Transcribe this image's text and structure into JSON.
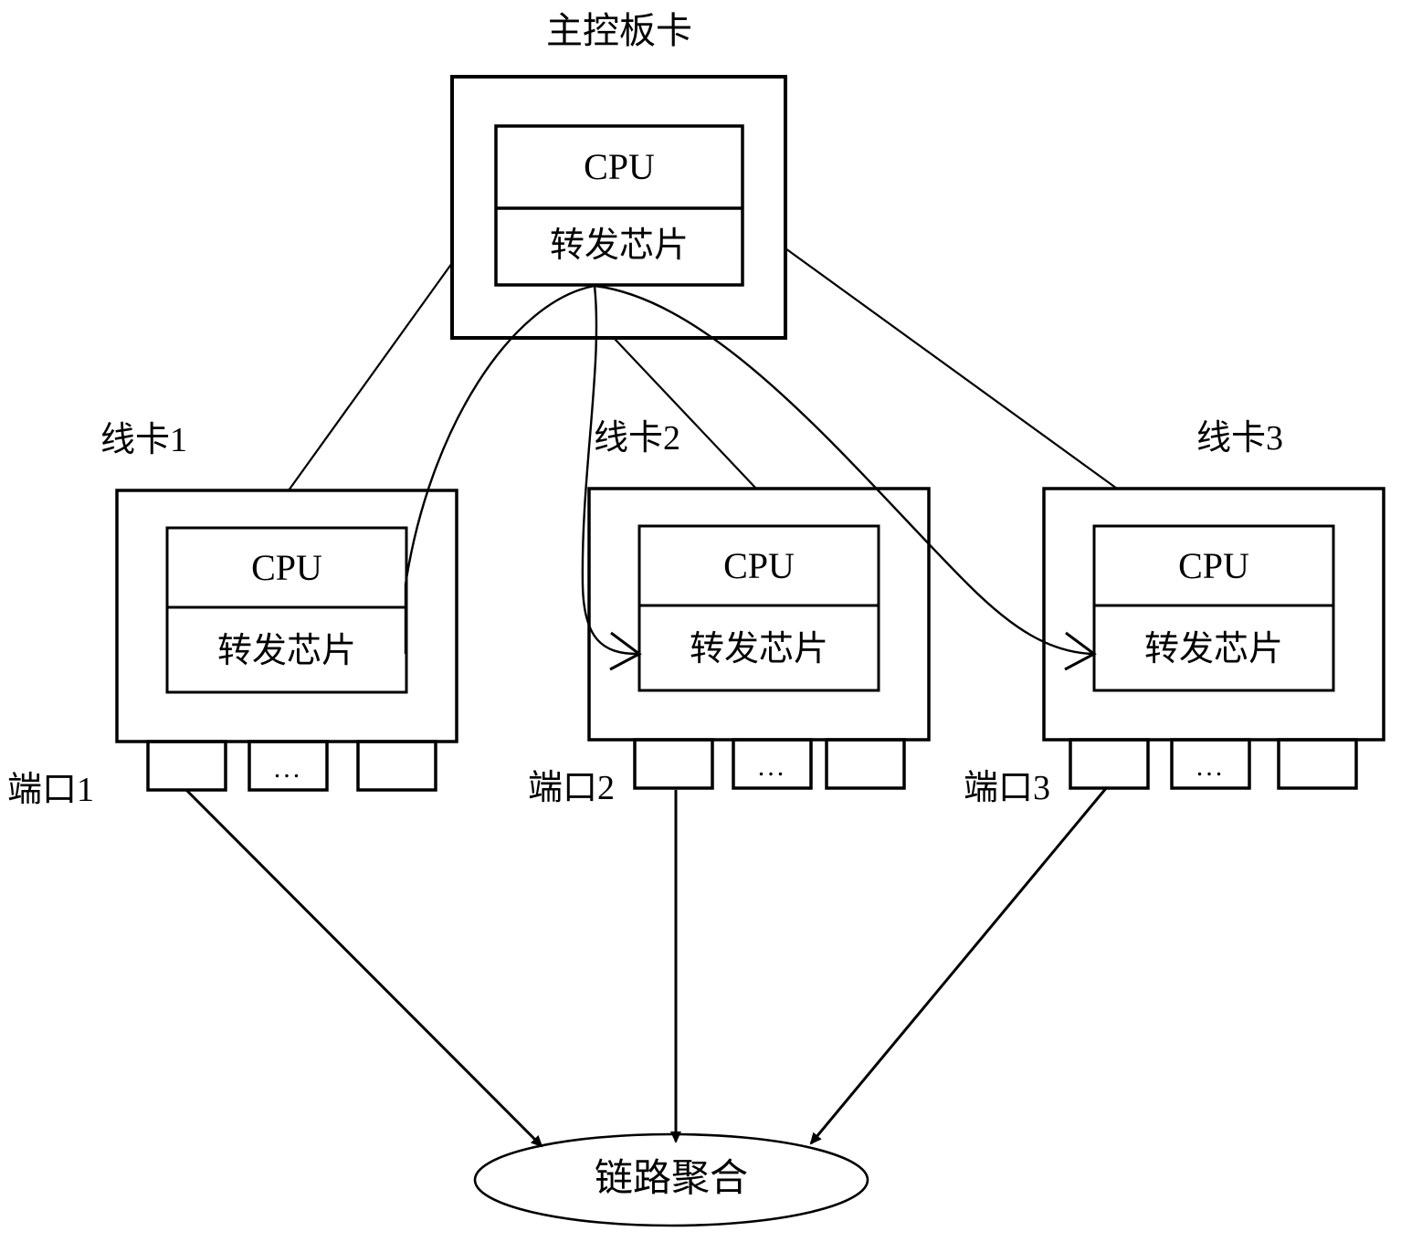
{
  "diagram": {
    "title": "主控板卡",
    "main_board": {
      "label": "主控板卡",
      "cpu_label": "CPU",
      "chip_label": "转发芯片"
    },
    "line_cards": [
      {
        "label": "线卡1",
        "cpu_label": "CPU",
        "chip_label": "转发芯片",
        "port_label": "端口1",
        "ports": [
          "",
          "...",
          ""
        ]
      },
      {
        "label": "线卡2",
        "cpu_label": "CPU",
        "chip_label": "转发芯片",
        "port_label": "端口2",
        "ports": [
          "",
          "...",
          ""
        ]
      },
      {
        "label": "线卡3",
        "cpu_label": "CPU",
        "chip_label": "转发芯片",
        "port_label": "端口3",
        "ports": [
          "",
          "...",
          ""
        ]
      }
    ],
    "aggregation": {
      "label": "链路聚合"
    },
    "colors": {
      "stroke": "#000000",
      "background": "#ffffff"
    }
  }
}
